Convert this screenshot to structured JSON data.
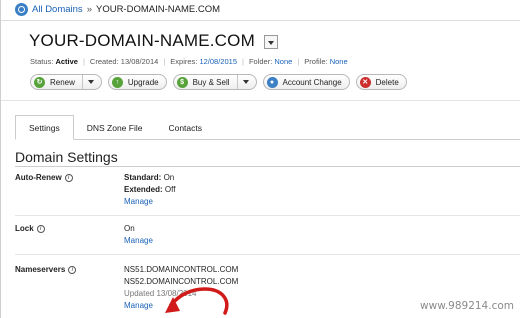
{
  "breadcrumb": {
    "link": "All Domains",
    "separator": "»",
    "current": "YOUR-DOMAIN-NAME.COM"
  },
  "domain": {
    "title": "YOUR-DOMAIN-NAME.COM"
  },
  "meta": {
    "status_label": "Status:",
    "status_value": "Active",
    "created": "Created: 13/08/2014",
    "expires_label": "Expires:",
    "expires_value": "12/08/2015",
    "folder_label": "Folder:",
    "folder_value": "None",
    "profile_label": "Profile:",
    "profile_value": "None"
  },
  "actions": {
    "renew": "Renew",
    "upgrade": "Upgrade",
    "buy_sell": "Buy & Sell",
    "account_change": "Account Change",
    "delete": "Delete"
  },
  "tabs": [
    {
      "label": "Settings"
    },
    {
      "label": "DNS Zone File"
    },
    {
      "label": "Contacts"
    }
  ],
  "section": {
    "title": "Domain Settings"
  },
  "rows": {
    "auto_renew": {
      "label": "Auto-Renew",
      "standard_label": "Standard:",
      "standard_value": "On",
      "extended_label": "Extended:",
      "extended_value": "Off",
      "manage": "Manage"
    },
    "lock": {
      "label": "Lock",
      "value": "On",
      "manage": "Manage"
    },
    "nameservers": {
      "label": "Nameservers",
      "ns1": "NS51.DOMAINCONTROL.COM",
      "ns2": "NS52.DOMAINCONTROL.COM",
      "updated": "Updated 13/08/2014",
      "manage": "Manage"
    }
  },
  "watermark": "www.989214.com",
  "colors": {
    "link": "#1a62b8",
    "annotation_arrow": "#d11a1a"
  }
}
